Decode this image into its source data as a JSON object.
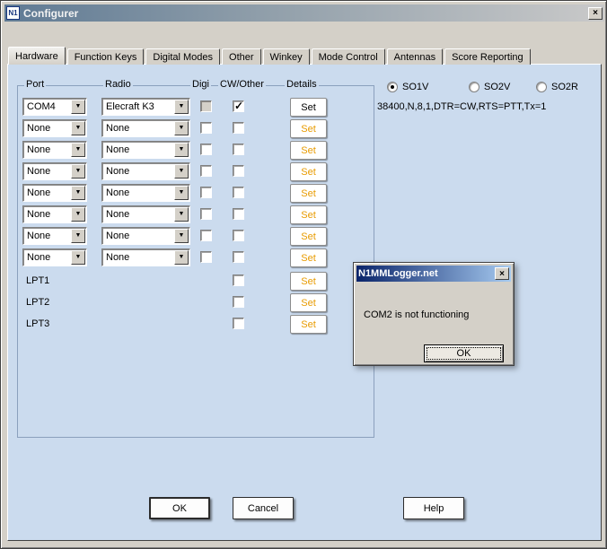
{
  "window": {
    "title": "Configurer",
    "icon_text": "N1"
  },
  "tabs": {
    "items": [
      "Hardware",
      "Function Keys",
      "Digital Modes",
      "Other",
      "Winkey",
      "Mode Control",
      "Antennas",
      "Score Reporting"
    ],
    "selected": "Hardware"
  },
  "hardware": {
    "headers": {
      "port": "Port",
      "radio": "Radio",
      "digi": "Digi",
      "cw_other": "CW/Other",
      "details": "Details"
    },
    "set_label": "Set",
    "rows": [
      {
        "port": "COM4",
        "radio": "Elecraft K3",
        "digi_checked": false,
        "digi_disabled": true,
        "cw_checked": true,
        "set_style": "black"
      },
      {
        "port": "None",
        "radio": "None",
        "digi_checked": false,
        "digi_disabled": false,
        "cw_checked": false,
        "set_style": "orange"
      },
      {
        "port": "None",
        "radio": "None",
        "digi_checked": false,
        "digi_disabled": false,
        "cw_checked": false,
        "set_style": "orange"
      },
      {
        "port": "None",
        "radio": "None",
        "digi_checked": false,
        "digi_disabled": false,
        "cw_checked": false,
        "set_style": "orange"
      },
      {
        "port": "None",
        "radio": "None",
        "digi_checked": false,
        "digi_disabled": false,
        "cw_checked": false,
        "set_style": "orange"
      },
      {
        "port": "None",
        "radio": "None",
        "digi_checked": false,
        "digi_disabled": false,
        "cw_checked": false,
        "set_style": "orange"
      },
      {
        "port": "None",
        "radio": "None",
        "digi_checked": false,
        "digi_disabled": false,
        "cw_checked": false,
        "set_style": "orange"
      },
      {
        "port": "None",
        "radio": "None",
        "digi_checked": false,
        "digi_disabled": false,
        "cw_checked": false,
        "set_style": "orange"
      }
    ],
    "lpt_rows": [
      {
        "label": "LPT1",
        "cw_checked": false
      },
      {
        "label": "LPT2",
        "cw_checked": false
      },
      {
        "label": "LPT3",
        "cw_checked": false
      }
    ],
    "modes": [
      {
        "label": "SO1V",
        "selected": true
      },
      {
        "label": "SO2V",
        "selected": false
      },
      {
        "label": "SO2R",
        "selected": false
      }
    ],
    "port_settings": "38400,N,8,1,DTR=CW,RTS=PTT,Tx=1"
  },
  "popup": {
    "title": "N1MMLogger.net",
    "message": "COM2 is not functioning",
    "ok_label": "OK"
  },
  "footer": {
    "ok": "OK",
    "cancel": "Cancel",
    "help": "Help"
  },
  "colors": {
    "active_title": "#0a246a",
    "panel_bg": "#cbdbee",
    "set_orange": "#e89b00"
  }
}
